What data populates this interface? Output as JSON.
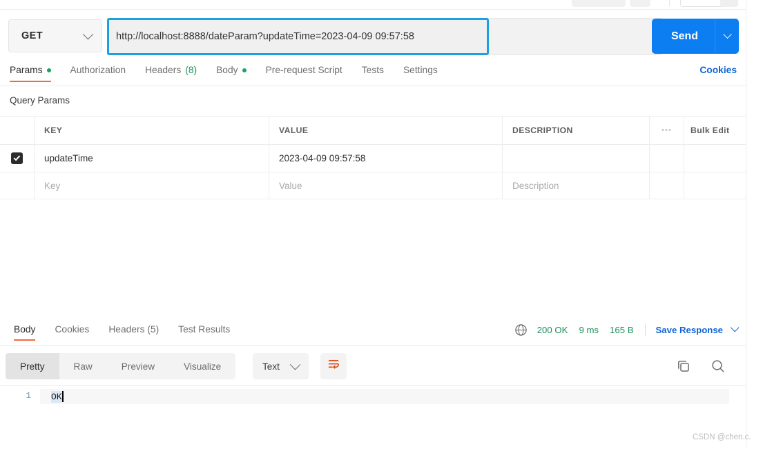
{
  "request": {
    "method": "GET",
    "url": "http://localhost:8888/dateParam?updateTime=2023-04-09 09:57:58",
    "send_label": "Send",
    "cookies_label": "Cookies",
    "tabs": [
      {
        "label": "Params",
        "dot": true,
        "active": true
      },
      {
        "label": "Authorization",
        "dot": false,
        "active": false
      },
      {
        "label": "Headers",
        "count": "(8)",
        "dot": false,
        "active": false
      },
      {
        "label": "Body",
        "dot": true,
        "active": false
      },
      {
        "label": "Pre-request Script",
        "dot": false,
        "active": false
      },
      {
        "label": "Tests",
        "dot": false,
        "active": false
      },
      {
        "label": "Settings",
        "dot": false,
        "active": false
      }
    ]
  },
  "params": {
    "section_title": "Query Params",
    "columns": [
      "KEY",
      "VALUE",
      "DESCRIPTION"
    ],
    "bulk_edit_label": "Bulk Edit",
    "rows": [
      {
        "checked": true,
        "key": "updateTime",
        "value": "2023-04-09 09:57:58",
        "description": ""
      }
    ],
    "placeholder_row": {
      "key": "Key",
      "value": "Value",
      "description": "Description"
    }
  },
  "response": {
    "tabs": [
      {
        "label": "Body",
        "active": true
      },
      {
        "label": "Cookies",
        "active": false
      },
      {
        "label": "Headers (5)",
        "active": false
      },
      {
        "label": "Test Results",
        "active": false
      }
    ],
    "status": "200 OK",
    "time": "9 ms",
    "size": "165 B",
    "save_label": "Save Response",
    "view_modes": [
      {
        "label": "Pretty",
        "active": true
      },
      {
        "label": "Raw",
        "active": false
      },
      {
        "label": "Preview",
        "active": false
      },
      {
        "label": "Visualize",
        "active": false
      }
    ],
    "format": "Text",
    "body_lines": [
      {
        "no": "1",
        "text": "OK"
      }
    ]
  },
  "watermark": "CSDN @chen.c.",
  "colors": {
    "accent_orange": "#f26b3a",
    "link_blue": "#1064d6",
    "send_blue": "#0c7ef2",
    "status_green": "#1c8f5a",
    "focus_blue": "#1ca0e3"
  }
}
